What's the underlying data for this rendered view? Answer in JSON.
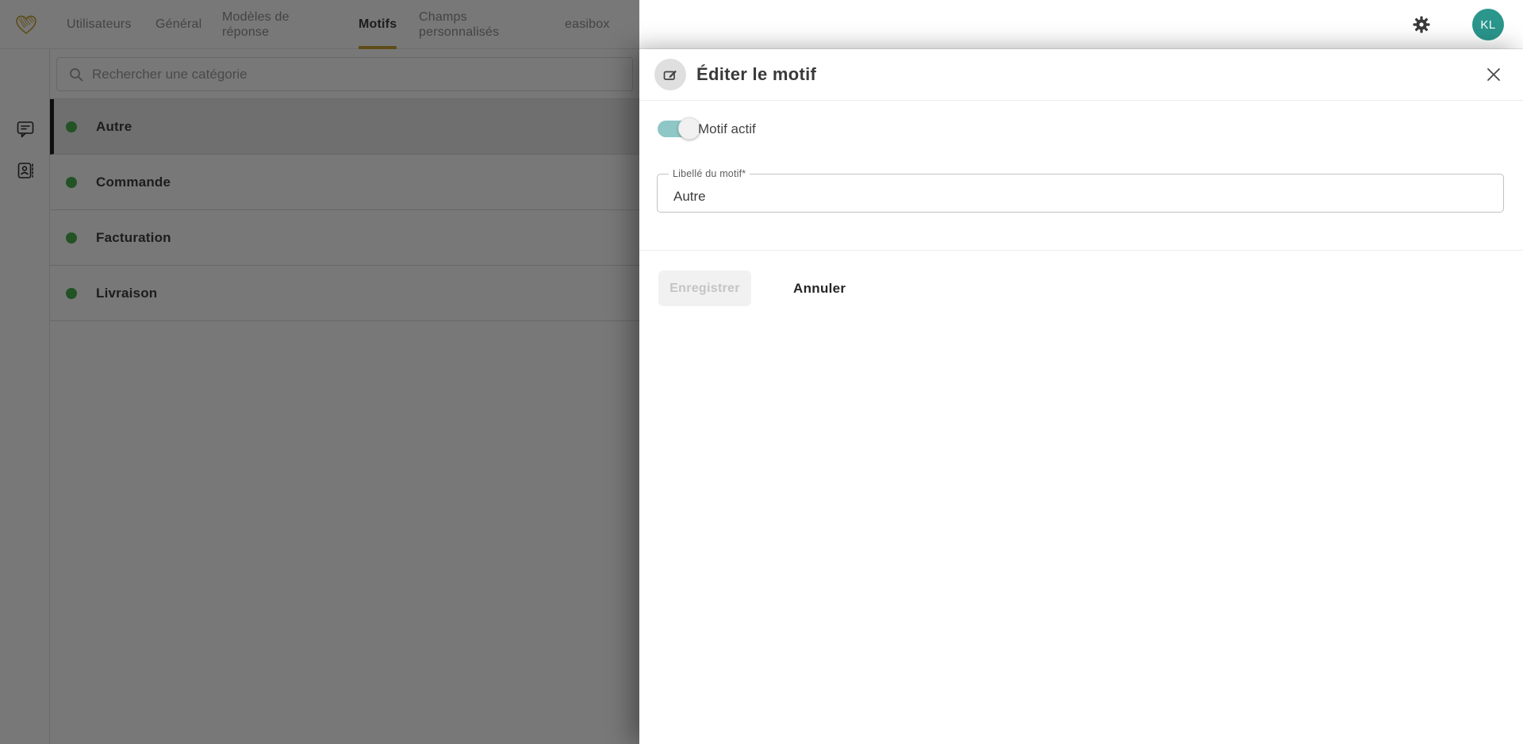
{
  "app": {
    "logo_icon": "heart-scribble-icon",
    "nav_tabs": [
      {
        "label": "Utilisateurs",
        "active": false
      },
      {
        "label": "Général",
        "active": false
      },
      {
        "label": "Modèles de réponse",
        "active": false
      },
      {
        "label": "Motifs",
        "active": true
      },
      {
        "label": "Champs personnalisés",
        "active": false
      },
      {
        "label": "easibox",
        "active": false
      }
    ],
    "toolbar": {
      "settings_icon": "gear-icon",
      "avatar_initials": "KL"
    }
  },
  "sidebar": {
    "icons": [
      "comment-bubble-icon",
      "contact-card-icon"
    ]
  },
  "category_panel": {
    "search_placeholder": "Rechercher une catégorie",
    "search_icon": "search-icon",
    "items": [
      {
        "label": "Autre",
        "selected": true
      },
      {
        "label": "Commande",
        "selected": false
      },
      {
        "label": "Facturation",
        "selected": false
      },
      {
        "label": "Livraison",
        "selected": false
      }
    ]
  },
  "drawer": {
    "title": "Éditer le motif",
    "title_icon": "edit-icon",
    "close_icon": "close-icon",
    "toggle": {
      "label": "Motif actif",
      "checked": true
    },
    "field": {
      "label": "Libellé du motif*",
      "value": "Autre"
    },
    "buttons": {
      "save": "Enregistrer",
      "save_disabled": true,
      "cancel": "Annuler"
    }
  },
  "colors": {
    "accent_gold": "#c6a232",
    "avatar_teal": "#2a968c",
    "toggle_teal": "#8fc6c6",
    "dot_green": "#4caf50",
    "selected_row_bg": "#ececec",
    "selected_row_bar": "#202020",
    "backdrop": "rgba(0,0,0,0.53)"
  }
}
